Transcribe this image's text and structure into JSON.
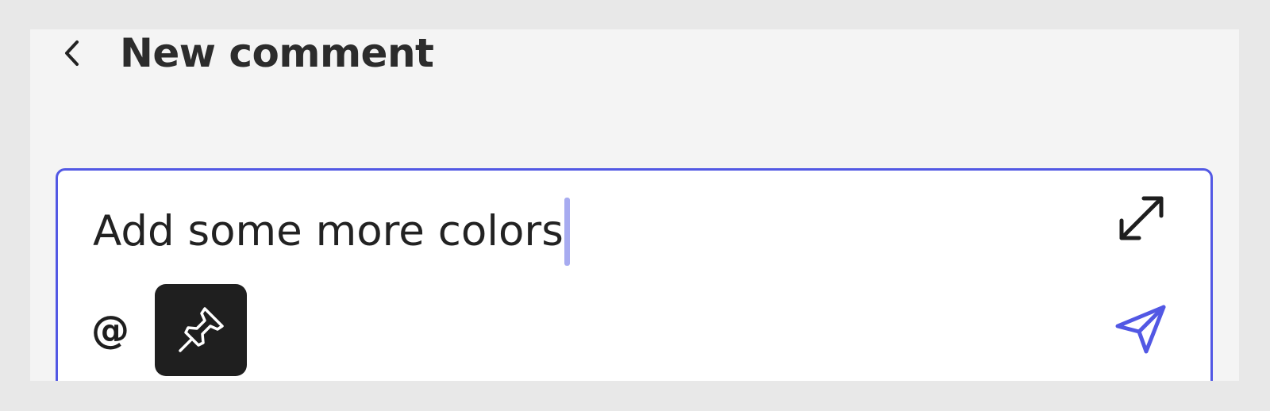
{
  "header": {
    "back_icon": "chevron-left-icon",
    "title": "New comment"
  },
  "composer": {
    "value": "Add some more colors",
    "focused": true,
    "expand_icon": "expand-diagonal-icon",
    "mention_symbol": "@",
    "pin_icon": "pushpin-icon",
    "pin_active": true,
    "send_icon": "send-paper-plane-icon"
  },
  "colors": {
    "accent": "#5258e4",
    "panel_background": "#f4f4f4",
    "page_background": "#e8e8e8",
    "pin_button_background": "#1f1f1f",
    "caret": "#a7abf0"
  }
}
